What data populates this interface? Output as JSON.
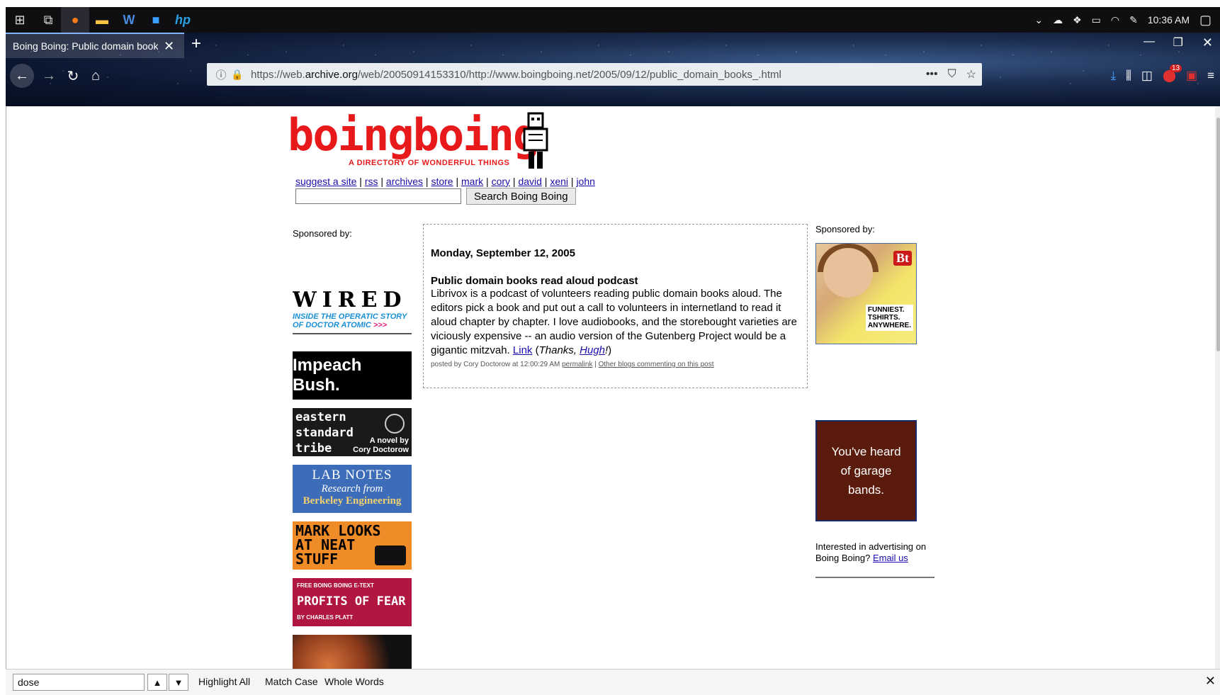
{
  "taskbar": {
    "clock": "10:36 AM"
  },
  "browser": {
    "tab_title": "Boing Boing: Public domain books",
    "url_prefix": "https://web.",
    "url_domain": "archive.org",
    "url_rest": "/web/20050914153310/http://www.boingboing.net/2005/09/12/public_domain_books_.html",
    "notification_badge": "13"
  },
  "site": {
    "logo_word": "boingboing",
    "logo_tagline": "A DIRECTORY OF WONDERFUL THINGS",
    "nav": [
      "suggest a site",
      "rss",
      "archives",
      "store",
      "mark",
      "cory",
      "david",
      "xeni",
      "john"
    ],
    "search_button": "Search Boing Boing"
  },
  "left_sidebar": {
    "sponsored_label": "Sponsored by:",
    "ads": {
      "wired": {
        "word": "WIRED",
        "sub1": "INSIDE THE OPERATIC STORY",
        "sub2": "OF DOCTOR ATOMIC",
        "arrows": ">>>"
      },
      "impeach": "Impeach Bush.",
      "eastern": {
        "title1": "eastern",
        "title2": "standard",
        "title3": "tribe",
        "by1": "A novel by",
        "by2": "Cory Doctorow"
      },
      "lab": {
        "line1": "LAB NOTES",
        "line2": "Research from",
        "line3": "Berkeley Engineering"
      },
      "mark": {
        "line1": "MARK LOOKS",
        "line2": "AT NEAT",
        "line3": "STUFF"
      },
      "profits": {
        "line1": "FREE BOING BOING E-TEXT",
        "line2": "PROFITS OF FEAR",
        "line3": "BY CHARLES PLATT"
      }
    }
  },
  "post": {
    "date": "Monday, September 12, 2005",
    "title": "Public domain books read aloud podcast",
    "body": "Librivox is a podcast of volunteers reading public domain books aloud. The editors pick a book and put out a call to volunteers in internetland to read it aloud chapter by chapter. I love audiobooks, and the storebought varieties are viciously expensive -- an audio version of the Gutenberg Project would be a gigantic mitzvah. ",
    "link_label": "Link",
    "thanks_prefix": "Thanks, ",
    "thanks_name": "Hugh",
    "thanks_suffix": "!",
    "meta_prefix": "posted by Cory Doctorow at 12:00:29 AM ",
    "permalink": "permalink",
    "other_blogs": "Other blogs commenting on this post"
  },
  "right_sidebar": {
    "sponsored_label": "Sponsored by:",
    "bt": {
      "logo": "Bt",
      "line1": "FUNNIEST.",
      "line2": "TSHIRTS.",
      "line3": "ANYWHERE."
    },
    "garage": {
      "line1": "You've heard",
      "line2": "of garage",
      "line3": "bands."
    },
    "advertise_text": "Interested in advertising on Boing Boing? ",
    "email_link": "Email us"
  },
  "findbar": {
    "query": "dose",
    "highlight_all": "Highlight All",
    "match_case": "Match Case",
    "whole_words": "Whole Words"
  }
}
